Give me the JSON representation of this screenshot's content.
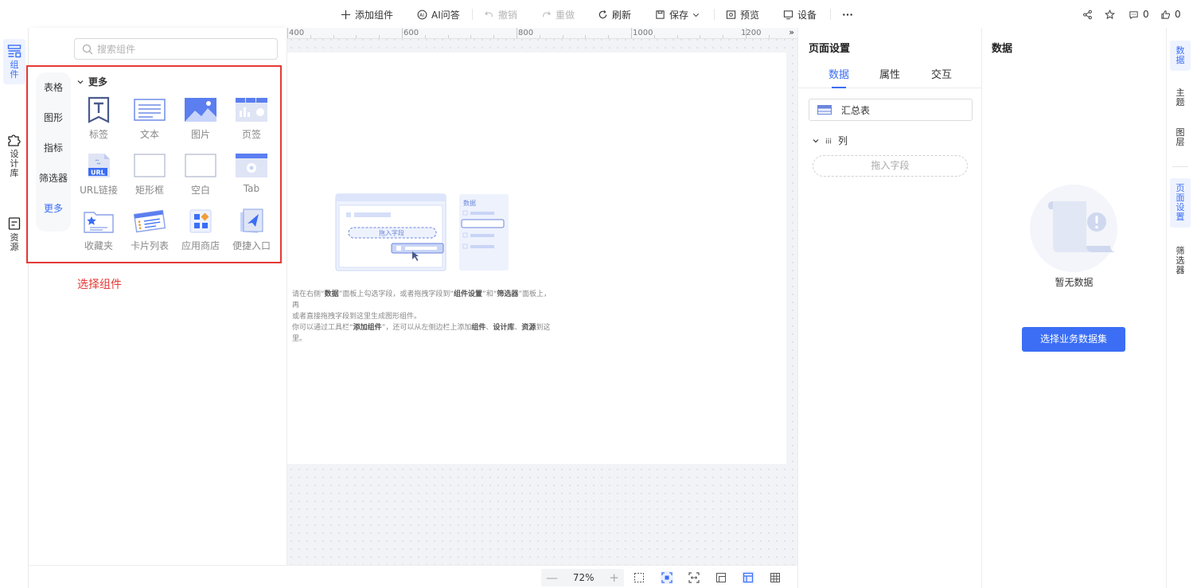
{
  "toolbar": {
    "add_component": "添加组件",
    "ai_qa": "AI问答",
    "undo": "撤销",
    "redo": "重做",
    "refresh": "刷新",
    "save": "保存",
    "preview": "预览",
    "device": "设备",
    "comment_count": "0",
    "like_count": "0"
  },
  "left_rail": [
    {
      "label": [
        "组",
        "件"
      ],
      "icon": "component-icon"
    },
    {
      "label": [
        "设",
        "计",
        "库"
      ],
      "icon": "puzzle-icon"
    },
    {
      "label": [
        "资",
        "源"
      ],
      "icon": "resource-icon"
    }
  ],
  "component_panel": {
    "search_placeholder": "搜索组件",
    "categories": [
      "表格",
      "图形",
      "指标",
      "筛选器",
      "更多"
    ],
    "active_category": "更多",
    "section_title": "更多",
    "components": [
      {
        "label": "标签",
        "icon": "label-icon"
      },
      {
        "label": "文本",
        "icon": "text-icon"
      },
      {
        "label": "图片",
        "icon": "image-icon"
      },
      {
        "label": "页签",
        "icon": "tabs-page-icon"
      },
      {
        "label": "URL链接",
        "icon": "url-icon"
      },
      {
        "label": "矩形框",
        "icon": "rectangle-icon"
      },
      {
        "label": "空白",
        "icon": "blank-icon"
      },
      {
        "label": "Tab",
        "icon": "tab-icon"
      },
      {
        "label": "收藏夹",
        "icon": "favorites-icon"
      },
      {
        "label": "卡片列表",
        "icon": "card-list-icon"
      },
      {
        "label": "应用商店",
        "icon": "app-store-icon"
      },
      {
        "label": "便捷入口",
        "icon": "quick-entry-icon"
      }
    ],
    "annotation": "选择组件"
  },
  "canvas": {
    "ruler_labels": [
      "400",
      "600",
      "800",
      "1000",
      "1200"
    ],
    "ruler_arrow": "»",
    "illustration": {
      "drag_field": "拖入字段",
      "data_label": "数据"
    },
    "hint_lines": [
      [
        "请在右侧“",
        "数据",
        "”面板上勾选字段，或者拖拽字段到“",
        "组件设置",
        "”和“",
        "筛选器",
        "”面板上，再"
      ],
      [
        "或者直接拖拽字段到这里生成图形组件。"
      ],
      [
        "你可以通过工具栏“",
        "添加组件",
        "”，还可以从左侧边栏上添加",
        "组件",
        "、",
        "设计库",
        "、",
        "资源",
        "到这"
      ],
      [
        "里。"
      ]
    ]
  },
  "statusbar": {
    "zoom_minus": "—",
    "zoom_level": "72%",
    "zoom_plus": "+"
  },
  "page_settings": {
    "title": "页面设置",
    "tabs": [
      "数据",
      "属性",
      "交互"
    ],
    "active_tab": "数据",
    "dataset_name": "汇总表",
    "column_label": "列",
    "drop_placeholder": "拖入字段"
  },
  "data_panel": {
    "title": "数据",
    "empty_text": "暂无数据",
    "choose_button": "选择业务数据集"
  },
  "right_rail": [
    {
      "label": [
        "数",
        "据"
      ],
      "active": true
    },
    {
      "label": [
        "主",
        "题"
      ],
      "active": false
    },
    {
      "label": [
        "图",
        "层"
      ],
      "active": false
    },
    {
      "label": [
        "页",
        "面",
        "设",
        "置"
      ],
      "active": true
    },
    {
      "label": [
        "筛",
        "选",
        "器"
      ],
      "active": false
    }
  ],
  "colors": {
    "accent": "#3b6ef5",
    "annotation_red": "#e53935"
  }
}
